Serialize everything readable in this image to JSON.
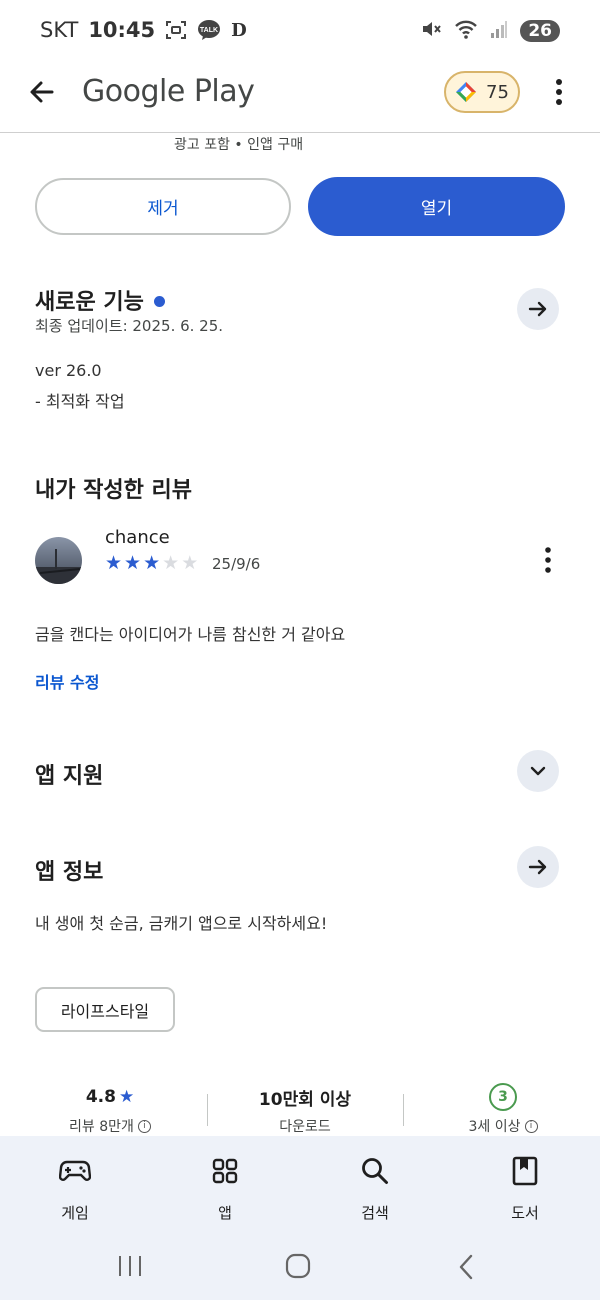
{
  "status_bar": {
    "carrier": "SKT",
    "time": "10:45",
    "talk_label": "TALK",
    "d_label": "D",
    "battery": "26"
  },
  "app_bar": {
    "title": "Google Play",
    "points": "75"
  },
  "ads_note": "광고 포함 • 인앱 구매",
  "actions": {
    "uninstall": "제거",
    "open": "열기"
  },
  "whats_new": {
    "title": "새로운 기능",
    "updated": "최종 업데이트: 2025. 6. 25.",
    "version": "ver 26.0",
    "notes": "- 최적화 작업"
  },
  "my_review": {
    "title": "내가 작성한 리뷰",
    "author": "chance",
    "rating": 3,
    "rating_max": 5,
    "date": "25/9/6",
    "text": "금을 캔다는 아이디어가 나름 참신한 거 같아요",
    "edit_label": "리뷰 수정"
  },
  "app_support": {
    "title": "앱 지원"
  },
  "app_info": {
    "title": "앱 정보",
    "description": "내 생애 첫 순금, 금캐기 앱으로 시작하세요!",
    "category_chip": "라이프스타일"
  },
  "stats": {
    "rating_value": "4.8",
    "rating_label": "리뷰 8만개",
    "downloads_value": "10만회 이상",
    "downloads_label": "다운로드",
    "age_value": "3",
    "age_label": "3세 이상"
  },
  "bottom_nav": {
    "items": [
      {
        "label": "게임",
        "icon": "gamepad-icon"
      },
      {
        "label": "앱",
        "icon": "apps-grid-icon"
      },
      {
        "label": "검색",
        "icon": "search-icon"
      },
      {
        "label": "도서",
        "icon": "book-icon"
      }
    ]
  },
  "colors": {
    "accent": "#2b5cd0",
    "link": "#0b57d0",
    "nav_bg": "#eef2f9",
    "age_green": "#4a9a4f"
  }
}
